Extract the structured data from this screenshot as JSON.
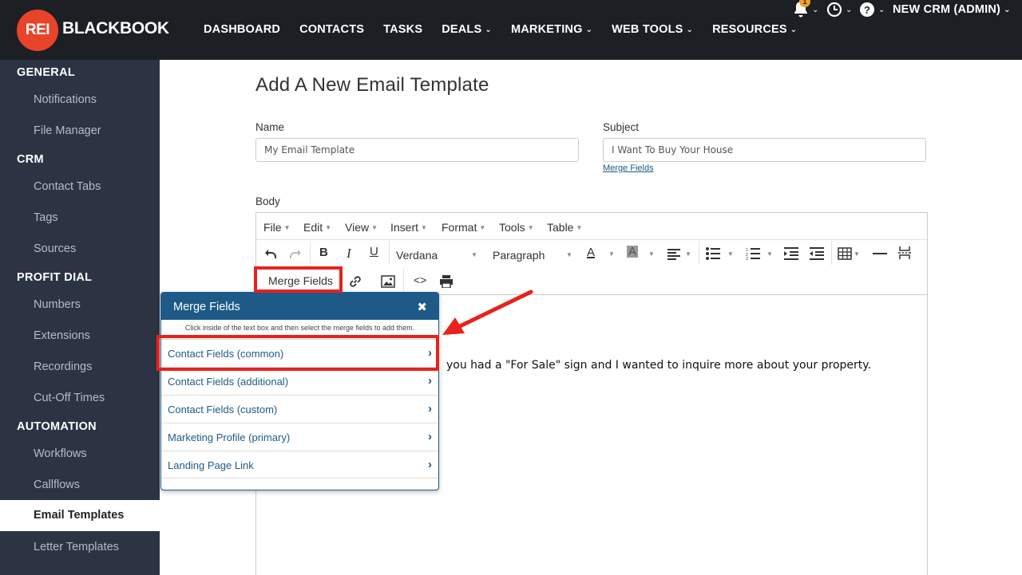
{
  "brand": {
    "badge": "REI",
    "name": "BLACKBOOK"
  },
  "nav": {
    "items": [
      {
        "label": "DASHBOARD",
        "dropdown": false
      },
      {
        "label": "CONTACTS",
        "dropdown": false
      },
      {
        "label": "TASKS",
        "dropdown": false
      },
      {
        "label": "DEALS",
        "dropdown": true
      },
      {
        "label": "MARKETING",
        "dropdown": true
      },
      {
        "label": "WEB TOOLS",
        "dropdown": true
      },
      {
        "label": "RESOURCES",
        "dropdown": true
      }
    ],
    "notifications_count": "1",
    "user": "NEW CRM (ADMIN)"
  },
  "sidebar": {
    "sections": [
      {
        "heading": "GENERAL",
        "items": [
          "Notifications",
          "File Manager"
        ]
      },
      {
        "heading": "CRM",
        "items": [
          "Contact Tabs",
          "Tags",
          "Sources"
        ]
      },
      {
        "heading": "PROFIT DIAL",
        "items": [
          "Numbers",
          "Extensions",
          "Recordings",
          "Cut-Off Times"
        ]
      },
      {
        "heading": "AUTOMATION",
        "items": [
          "Workflows",
          "Callflows",
          "Email Templates",
          "Letter Templates"
        ]
      }
    ],
    "active": "Email Templates"
  },
  "page": {
    "title": "Add A New Email Template",
    "name_label": "Name",
    "name_value": "My Email Template",
    "subject_label": "Subject",
    "subject_value": "I Want To Buy Your House",
    "merge_fields_link": "Merge Fields",
    "body_label": "Body"
  },
  "editor": {
    "menu": [
      "File",
      "Edit",
      "View",
      "Insert",
      "Format",
      "Tools",
      "Table"
    ],
    "font_family": "Verdana",
    "block_format": "Paragraph",
    "merge_fields_button": "Merge Fields",
    "content_text": "you had a \"For Sale\" sign and I wanted to inquire more about your property."
  },
  "popup": {
    "title": "Merge Fields",
    "hint": "Click inside of the text box and then select the merge fields to add them.",
    "items": [
      "Contact Fields (common)",
      "Contact Fields (additional)",
      "Contact Fields (custom)",
      "Marketing Profile (primary)",
      "Landing Page Link"
    ]
  },
  "colors": {
    "topbar": "#1c1f24",
    "sidebar": "#2c3443",
    "brand_red": "#e8442a",
    "popup_blue": "#1d5a87",
    "highlight_red": "#e8221d",
    "badge_orange": "#f0a12a"
  }
}
